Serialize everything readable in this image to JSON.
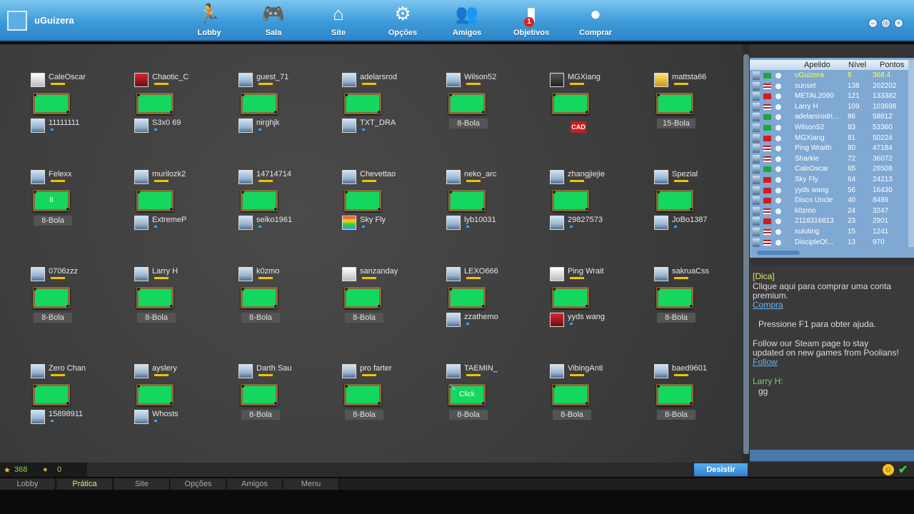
{
  "app": {
    "title": "uGuizera"
  },
  "nav": [
    {
      "label": "Lobby",
      "icon": "runner-icon"
    },
    {
      "label": "Sala",
      "icon": "gamepad-icon"
    },
    {
      "label": "Site",
      "icon": "house-icon"
    },
    {
      "label": "Opções",
      "icon": "gear-icon"
    },
    {
      "label": "Amigos",
      "icon": "friends-icon"
    },
    {
      "label": "Objetivos",
      "icon": "chart-icon",
      "badge": "1"
    },
    {
      "label": "Comprar",
      "icon": "coins-icon"
    }
  ],
  "tables": [
    {
      "top": "CaleOscar",
      "bottom": "11111111",
      "mode": ""
    },
    {
      "top": "Chaotic_C",
      "bottom": "S3x0 69",
      "mode": ""
    },
    {
      "top": "guest_71",
      "bottom": "nirghjk",
      "mode": ""
    },
    {
      "top": "adelarsrod",
      "bottom": "TXT_DRA",
      "mode": ""
    },
    {
      "top": "Wilson52",
      "bottom": "",
      "mode": "8-Bola"
    },
    {
      "top": "MGXiang",
      "bottom": "",
      "mode": "",
      "badge": "CAD"
    },
    {
      "top": "mattsta66",
      "bottom": "",
      "mode": "15-Bola"
    },
    {
      "top": "Felexx",
      "bottom": "",
      "mode": "8-Bola",
      "table_label": "8"
    },
    {
      "top": "murilozk2",
      "bottom": "ExtremeP",
      "mode": ""
    },
    {
      "top": "14714714",
      "bottom": "seiko1961",
      "mode": ""
    },
    {
      "top": "Chevettao",
      "bottom": "Sky Fly",
      "mode": ""
    },
    {
      "top": "neko_arc",
      "bottom": "lyb10031",
      "mode": ""
    },
    {
      "top": "zhangjiejie",
      "bottom": "29827573",
      "mode": ""
    },
    {
      "top": "Spezial",
      "bottom": "JoBo1387",
      "mode": ""
    },
    {
      "top": "0706zzz",
      "bottom": "",
      "mode": "8-Bola"
    },
    {
      "top": "Larry H",
      "bottom": "",
      "mode": "8-Bola"
    },
    {
      "top": "k0zmo",
      "bottom": "",
      "mode": "8-Bola"
    },
    {
      "top": "sanzanday",
      "bottom": "",
      "mode": "8-Bola"
    },
    {
      "top": "LEXO666",
      "bottom": "zzathemo",
      "mode": ""
    },
    {
      "top": "Ping Wrait",
      "bottom": "yyds wang",
      "mode": ""
    },
    {
      "top": "sakruaCss",
      "bottom": "",
      "mode": "8-Bola"
    },
    {
      "top": "Zero Chan",
      "bottom": "15898911",
      "mode": ""
    },
    {
      "top": "ayslery",
      "bottom": "Whosts",
      "mode": ""
    },
    {
      "top": "Darth Sau",
      "bottom": "",
      "mode": "8-Bola"
    },
    {
      "top": "pro farter",
      "bottom": "",
      "mode": "8-Bola"
    },
    {
      "top": "TAEMIN_",
      "bottom": "",
      "mode": "8-Bola",
      "table_label": "Click"
    },
    {
      "top": "VibingAnti",
      "bottom": "",
      "mode": "8-Bola"
    },
    {
      "top": "baed9601",
      "bottom": "",
      "mode": "8-Bola"
    }
  ],
  "ranking": {
    "headers": {
      "name": "Apelido",
      "level": "Nível",
      "points": "Pontos"
    },
    "rows": [
      {
        "name": "uGuizera",
        "level": "8",
        "points": "368.4",
        "flag": "br"
      },
      {
        "name": "sunset",
        "level": "138",
        "points": "202202",
        "flag": "us"
      },
      {
        "name": "METAL2090",
        "level": "121",
        "points": "133382",
        "flag": "cn"
      },
      {
        "name": "Larry H",
        "level": "109",
        "points": "103698",
        "flag": "us"
      },
      {
        "name": "adelarsrodri...",
        "level": "86",
        "points": "58812",
        "flag": "br"
      },
      {
        "name": "Wilson52",
        "level": "83",
        "points": "53360",
        "flag": "br"
      },
      {
        "name": "MGXiang",
        "level": "81",
        "points": "50224",
        "flag": "cn"
      },
      {
        "name": "Ping Wraith",
        "level": "80",
        "points": "47184",
        "flag": "us"
      },
      {
        "name": "Sharkie",
        "level": "72",
        "points": "36072",
        "flag": "us"
      },
      {
        "name": "CaleOscar",
        "level": "65",
        "points": "26508",
        "flag": "br"
      },
      {
        "name": "Sky Fly",
        "level": "64",
        "points": "24213",
        "flag": "cn"
      },
      {
        "name": "yyds wang",
        "level": "56",
        "points": "16430",
        "flag": "cn"
      },
      {
        "name": "Disco Uncle",
        "level": "40",
        "points": "8489",
        "flag": "cn"
      },
      {
        "name": "k0zmo",
        "level": "24",
        "points": "3247",
        "flag": "us"
      },
      {
        "name": "2118316813",
        "level": "23",
        "points": "2901",
        "flag": "cn"
      },
      {
        "name": "xuluting",
        "level": "15",
        "points": "1241",
        "flag": "us"
      },
      {
        "name": "DiscipleOf...",
        "level": "13",
        "points": "970",
        "flag": "us"
      }
    ]
  },
  "chat": {
    "tip_tag": "[Dica]",
    "tip_line1": "Clique aqui para comprar uma conta",
    "tip_line2": "premium.",
    "tip_link": "Compra",
    "help": "Pressione F1 para obter ajuda.",
    "steam_line1": "Follow our Steam page to stay",
    "steam_line2": "updated on new games from Poolians!",
    "steam_link": "Follow",
    "msg_author": "Larry H:",
    "msg_text": "gg"
  },
  "stats": {
    "stars": "368",
    "coins": "0"
  },
  "buttons": {
    "desistir": "Desistir"
  },
  "bottom_tabs": [
    "Lobby",
    "Prática",
    "Site",
    "Opções",
    "Amigos",
    "Menu"
  ]
}
